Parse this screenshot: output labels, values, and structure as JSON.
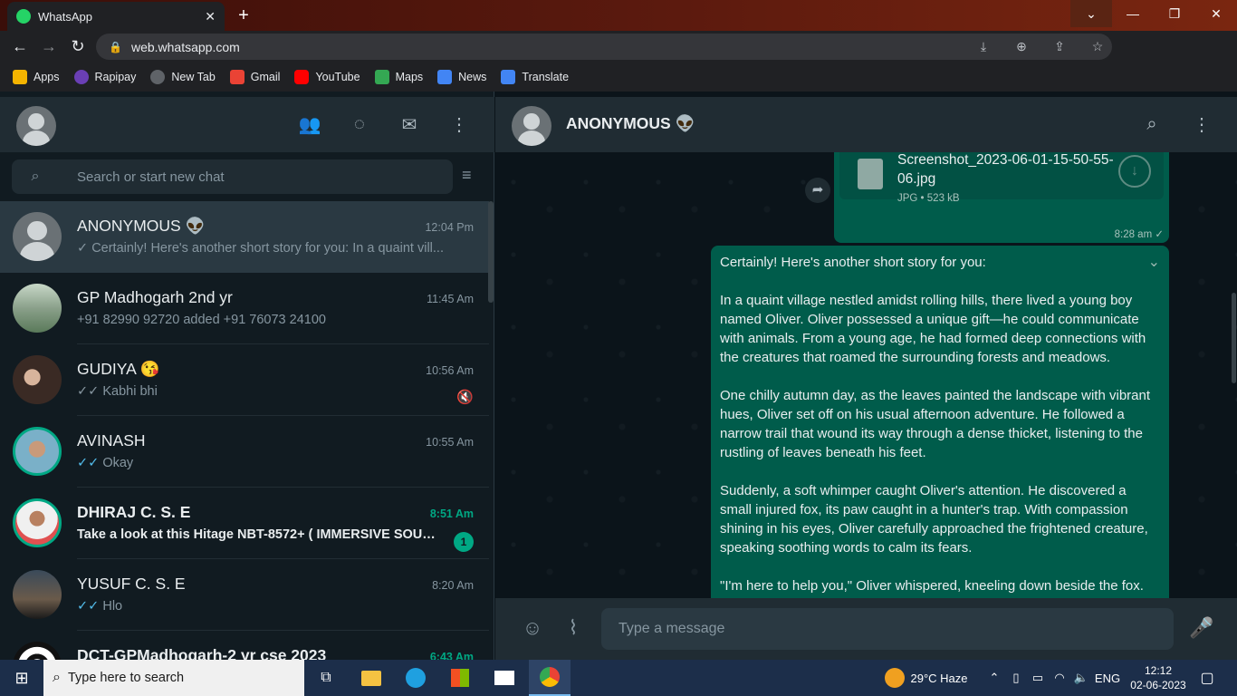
{
  "browser": {
    "tab_title": "WhatsApp",
    "url": "web.whatsapp.com",
    "bookmarks": [
      {
        "label": "Apps",
        "color": "#f4b400"
      },
      {
        "label": "Rapipay",
        "color": "#6a3fb5"
      },
      {
        "label": "New Tab",
        "color": "#5f6368"
      },
      {
        "label": "Gmail",
        "color": "#ea4335"
      },
      {
        "label": "YouTube",
        "color": "#ff0000"
      },
      {
        "label": "Maps",
        "color": "#34a853"
      },
      {
        "label": "News",
        "color": "#4285f4"
      },
      {
        "label": "Translate",
        "color": "#4285f4"
      }
    ]
  },
  "left": {
    "search_placeholder": "Search or start new chat",
    "chats": [
      {
        "name": "ANONYMOUS 👽",
        "time": "12:04 Pm",
        "tick": "✓",
        "preview": "Certainly! Here's another short story for you: In a quaint vill..."
      },
      {
        "name": "GP Madhogarh 2nd yr",
        "time": "11:45 Am",
        "tick": "",
        "preview": "+91 82990 92720 added +91 76073 24100"
      },
      {
        "name": "GUDIYA 😘",
        "time": "10:56 Am",
        "tick": "✓✓",
        "preview": "Kabhi bhi"
      },
      {
        "name": "AVINASH",
        "time": "10:55 Am",
        "tick": "✓✓",
        "preview": "Okay"
      },
      {
        "name": "DHIRAJ C. S. E",
        "time": "8:51 Am",
        "tick": "",
        "preview": "Take a look at this Hitage NBT-8572+ ( IMMERSIVE SOUND...",
        "unread": "1"
      },
      {
        "name": "YUSUF C. S. E",
        "time": "8:20 Am",
        "tick": "✓✓",
        "preview": "Hlo"
      },
      {
        "name": "DCT-GPMadhogarh-2 yr cse 2023",
        "time": "6:43 Am",
        "tick": "",
        "preview": ""
      }
    ]
  },
  "conversation": {
    "contact_name": "ANONYMOUS 👽",
    "document": {
      "file_name": "Screenshot_2023-06-01-15-50-55-06.jpg",
      "meta": "JPG • 523 kB",
      "time": "8:28 am ✓"
    },
    "message_paragraphs": [
      "Certainly! Here's another short story for you:",
      "In a quaint village nestled amidst rolling hills, there lived a young boy named Oliver. Oliver possessed a unique gift—he could communicate with animals. From a young age, he had formed deep connections with the creatures that roamed the surrounding forests and meadows.",
      "One chilly autumn day, as the leaves painted the landscape with vibrant hues, Oliver set off on his usual afternoon adventure. He followed a narrow trail that wound its way through a dense thicket, listening to the rustling of leaves beneath his feet.",
      "Suddenly, a soft whimper caught Oliver's attention. He discovered a small injured fox, its paw caught in a hunter's trap. With compassion shining in his eyes, Oliver carefully approached the frightened creature, speaking soothing words to calm its fears.",
      "\"I'm here to help you,\" Oliver whispered, kneeling down beside the fox. Gently, he released the trap, freeing the fox from its painful"
    ],
    "input_placeholder": "Type a message"
  },
  "taskbar": {
    "search_placeholder": "Type here to search",
    "weather": "29°C  Haze",
    "lang": "ENG",
    "time": "12:12",
    "date": "02-06-2023"
  },
  "icons": {
    "community": "community-icon",
    "status": "status-icon",
    "new_chat": "new-chat-icon",
    "menu": "menu-icon",
    "search": "search-icon",
    "filter": "filter-icon",
    "emoji": "emoji-icon",
    "attach": "attach-icon",
    "mic": "mic-icon"
  },
  "colors": {
    "accent": "#00a884",
    "panel": "#202c33",
    "outgoing_bubble": "#005c4b",
    "background": "#111b21"
  }
}
